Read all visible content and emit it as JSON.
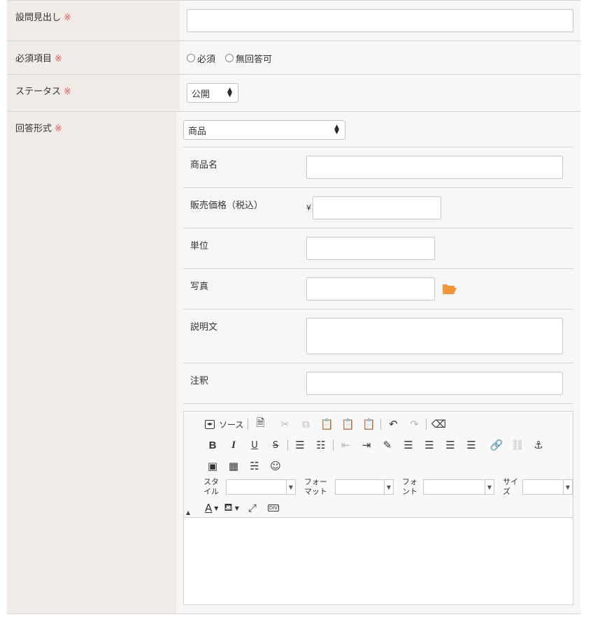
{
  "form": {
    "required_mark": "※",
    "heading": {
      "label": "設問見出し",
      "value": ""
    },
    "required_item": {
      "label": "必須項目",
      "options": [
        "必須",
        "無回答可"
      ]
    },
    "status": {
      "label": "ステータス",
      "value": "公開"
    },
    "answer_format": {
      "label": "回答形式",
      "value": "商品",
      "fields": {
        "product_name": {
          "label": "商品名",
          "value": ""
        },
        "price": {
          "label": "販売価格（税込）",
          "currency": "¥",
          "value": ""
        },
        "unit": {
          "label": "単位",
          "value": ""
        },
        "photo": {
          "label": "写真",
          "value": ""
        },
        "description": {
          "label": "説明文",
          "value": ""
        },
        "note": {
          "label": "注釈",
          "value": ""
        }
      }
    }
  },
  "editor": {
    "source_label": "ソース",
    "style_label": "スタ イル",
    "format_label": "フォー マット",
    "font_label": "フォ ント",
    "size_label": "サイ ズ",
    "icons": [
      "source-icon",
      "new-page-icon",
      "cut-icon",
      "copy-icon",
      "paste-icon",
      "paste-text-icon",
      "paste-word-icon",
      "undo-icon",
      "redo-icon",
      "remove-format-icon",
      "bold-icon",
      "italic-icon",
      "underline-icon",
      "strike-icon",
      "numbered-list-icon",
      "bulleted-list-icon",
      "outdent-icon",
      "indent-icon",
      "div-icon",
      "align-left-icon",
      "align-center-icon",
      "align-right-icon",
      "justify-icon",
      "link-icon",
      "unlink-icon",
      "anchor-icon",
      "image-icon",
      "table-icon",
      "page-break-icon",
      "smiley-icon",
      "text-color-icon",
      "bg-color-icon",
      "maximize-icon",
      "show-blocks-icon",
      "folder-icon"
    ]
  },
  "colors": {
    "label_bg": "#f0ebe6",
    "value_bg": "#f6f6f6",
    "required": "#e05a5a",
    "folder": "#f0953a"
  }
}
